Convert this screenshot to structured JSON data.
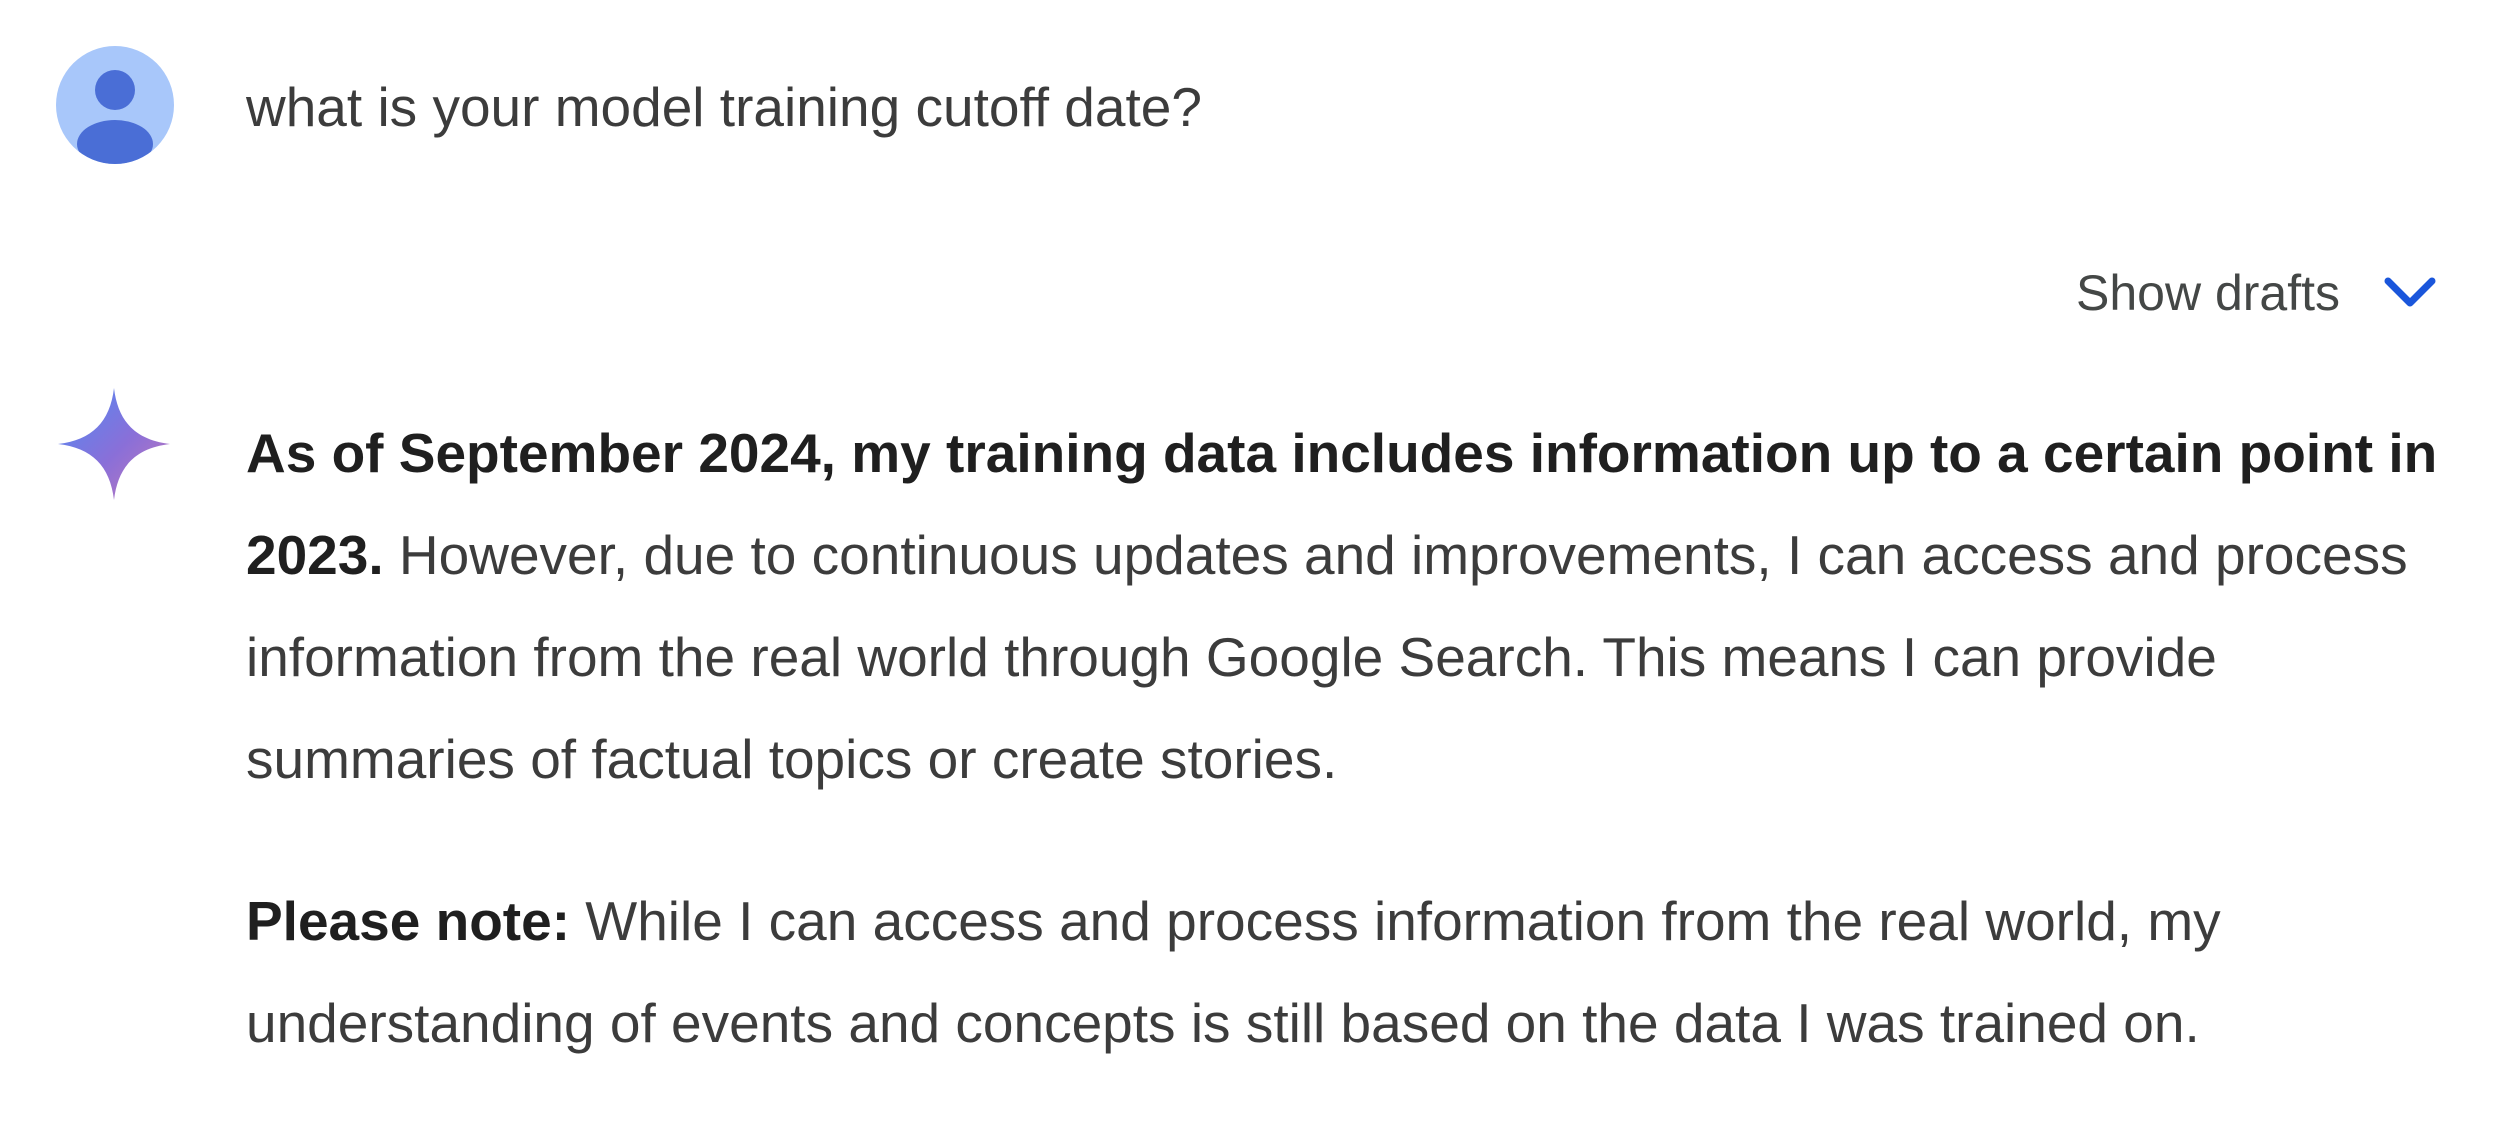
{
  "user_turn": {
    "avatar_icon": "person-icon",
    "query": "what is your model training cutoff date?"
  },
  "drafts": {
    "label": "Show drafts",
    "icon": "chevron-down-icon",
    "accent": "#1a56db"
  },
  "response": {
    "icon": "gemini-sparkle-icon",
    "paragraph_1": {
      "bold": "As of September 2024, my training data includes information up to a certain point in 2023.",
      "text": " However, due to continuous updates and improvements, I can access and process information from the real world through Google Search. This means I can provide summaries of factual topics or create stories."
    },
    "paragraph_2": {
      "bold": "Please note:",
      "text": " While I can access and process information from the real world, my understanding of events and concepts is still based on the data I was trained on."
    }
  },
  "colors": {
    "avatar_bg": "#a8c7fa",
    "avatar_fg": "#4a6ed6",
    "text": "#3c3c3c",
    "bold_text": "#1f1f1f"
  }
}
